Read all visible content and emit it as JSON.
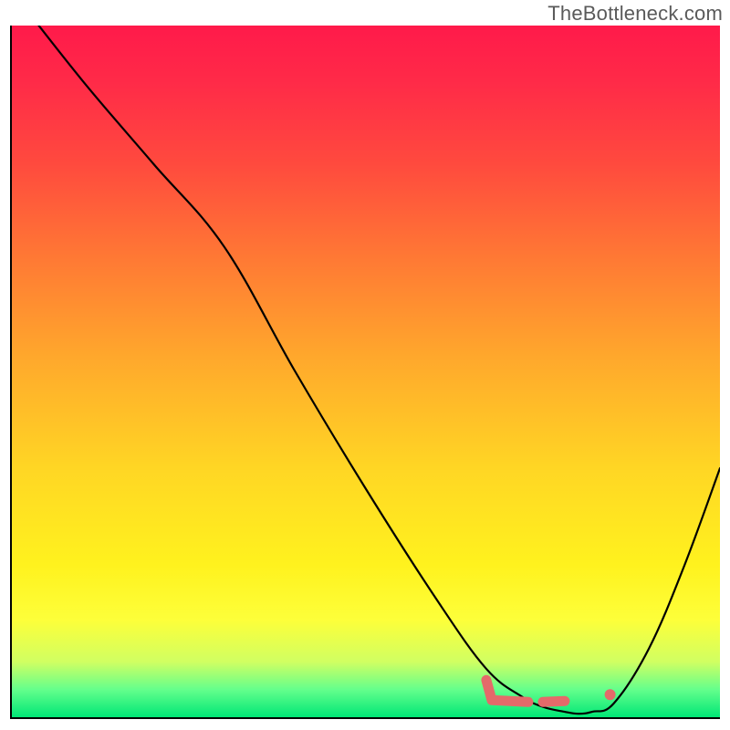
{
  "watermark": "TheBottleneck.com",
  "chart_data": {
    "type": "line",
    "title": "",
    "xlabel": "",
    "ylabel": "",
    "xlim": [
      0,
      100
    ],
    "ylim": [
      0,
      100
    ],
    "grid": false,
    "legend": false,
    "series": [
      {
        "name": "bottleneck-curve",
        "x": [
          0,
          10,
          20,
          30,
          40,
          50,
          60,
          67,
          72,
          75,
          78,
          80,
          82,
          85,
          90,
          95,
          100
        ],
        "y": [
          105,
          92,
          80,
          68,
          50,
          33,
          17,
          7,
          3,
          1.5,
          0.8,
          0.5,
          0.8,
          2,
          10,
          22,
          36
        ],
        "color": "#000000"
      }
    ],
    "highlight": {
      "name": "optimal-range",
      "x_range": [
        67,
        85
      ],
      "y": 3,
      "color": "#e46a6a"
    },
    "gradient_stops": [
      {
        "pos": 0.0,
        "color": "#ff1a4a"
      },
      {
        "pos": 0.5,
        "color": "#ffc824"
      },
      {
        "pos": 0.86,
        "color": "#fdff3a"
      },
      {
        "pos": 1.0,
        "color": "#00e676"
      }
    ]
  }
}
